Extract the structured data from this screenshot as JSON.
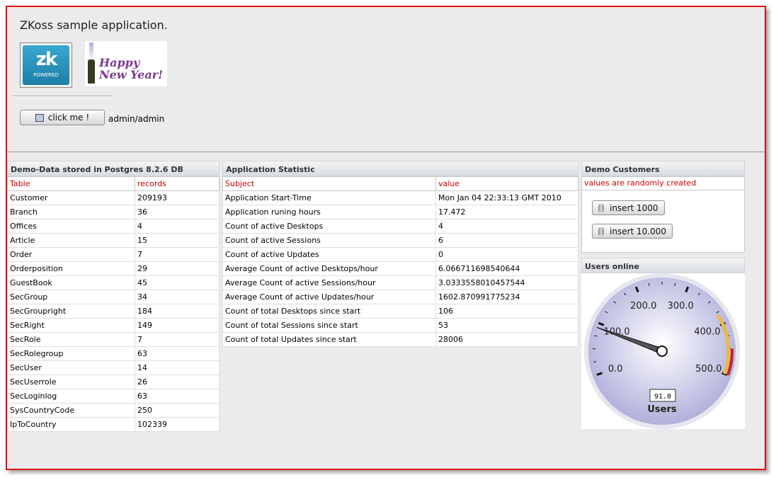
{
  "app": {
    "title": "ZKoss sample application."
  },
  "logos": {
    "zk_text": "zk",
    "zk_powered": "POWERED",
    "newyear_line1": "Happy",
    "newyear_line2": "New Year!"
  },
  "toolbar": {
    "click_label": "click me !",
    "credentials": "admin/admin"
  },
  "demo_data": {
    "title": "Demo-Data stored in Postgres 8.2.6 DB",
    "headers": [
      "Table",
      "records"
    ],
    "rows": [
      [
        "Customer",
        "209193"
      ],
      [
        "Branch",
        "36"
      ],
      [
        "Offices",
        "4"
      ],
      [
        "Article",
        "15"
      ],
      [
        "Order",
        "7"
      ],
      [
        "Orderposition",
        "29"
      ],
      [
        "GuestBook",
        "45"
      ],
      [
        "SecGroup",
        "34"
      ],
      [
        "SecGroupright",
        "184"
      ],
      [
        "SecRight",
        "149"
      ],
      [
        "SecRole",
        "7"
      ],
      [
        "SecRolegroup",
        "63"
      ],
      [
        "SecUser",
        "14"
      ],
      [
        "SecUserrole",
        "26"
      ],
      [
        "SecLoginlog",
        "63"
      ],
      [
        "SysCountryCode",
        "250"
      ],
      [
        "IpToCountry",
        "102339"
      ]
    ]
  },
  "app_stats": {
    "title": "Application Statistic",
    "headers": [
      "Subject",
      "value"
    ],
    "rows": [
      [
        "Application Start-Time",
        "Mon Jan 04 22:33:13 GMT 2010"
      ],
      [
        "Application runing hours",
        "17.472"
      ],
      [
        "Count of active Desktops",
        "4"
      ],
      [
        "Count of active Sessions",
        "6"
      ],
      [
        "Count of active Updates",
        "0"
      ],
      [
        "Average Count of active Desktops/hour",
        "6.066711698540644"
      ],
      [
        "Average Count of active Sessions/hour",
        "3.0333558010457544"
      ],
      [
        "Average Count of active Updates/hour",
        "1602.870991775234"
      ],
      [
        "Count of total Desktops since start",
        "106"
      ],
      [
        "Count of total Sessions since start",
        "53"
      ],
      [
        "Count of total Updates since start",
        "28006"
      ]
    ]
  },
  "customers": {
    "title": "Demo Customers",
    "note": "values are randomly created",
    "btn_1000": "insert 1000",
    "btn_10000": "insert 10.000"
  },
  "users_online": {
    "title": "Users online",
    "ticks": [
      "0.0",
      "100.0",
      "200.0",
      "300.0",
      "400.0",
      "500.0"
    ],
    "value": 91.0,
    "value_label": "91.0",
    "min": 0,
    "max": 500,
    "dial_label": "Users"
  },
  "colors": {
    "frame": "#e01010",
    "header_text": "#cc0000",
    "warn_band": "#e9b84a",
    "crit_band": "#cc2020"
  }
}
